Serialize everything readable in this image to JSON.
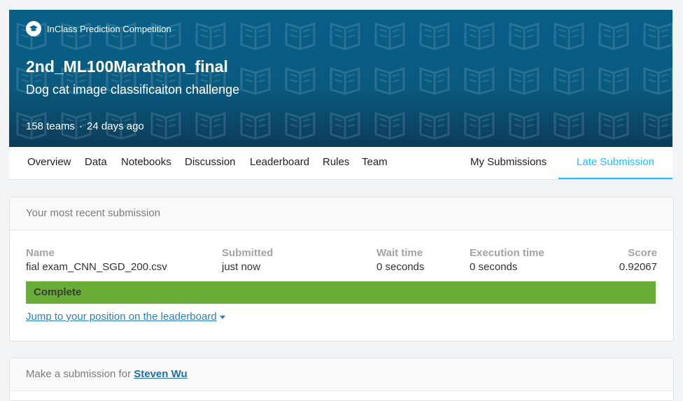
{
  "banner": {
    "badge_label": "InClass Prediction Competition",
    "title": "2nd_ML100Marathon_final",
    "subtitle": "Dog cat image classificaiton challenge",
    "teams": "158 teams",
    "separator": "·",
    "age": "24 days ago"
  },
  "tabs": {
    "overview": "Overview",
    "data": "Data",
    "notebooks": "Notebooks",
    "discussion": "Discussion",
    "leaderboard": "Leaderboard",
    "rules": "Rules",
    "team": "Team",
    "my_submissions": "My Submissions",
    "late_submission": "Late Submission"
  },
  "recent_submission": {
    "header": "Your most recent submission",
    "columns": {
      "name": "Name",
      "submitted": "Submitted",
      "wait_time": "Wait time",
      "execution_time": "Execution time",
      "score": "Score"
    },
    "values": {
      "name": "fial exam_CNN_SGD_200.csv",
      "submitted": "just now",
      "wait_time": "0 seconds",
      "execution_time": "0 seconds",
      "score": "0.92067"
    },
    "status": "Complete",
    "jump_link": "Jump to your position on the leaderboard"
  },
  "make_submission": {
    "prefix": "Make a submission for",
    "user": "Steven Wu"
  },
  "colors": {
    "banner": "#085f87",
    "accent": "#20beff",
    "complete": "#6aad36",
    "link": "#2a7fb8"
  }
}
